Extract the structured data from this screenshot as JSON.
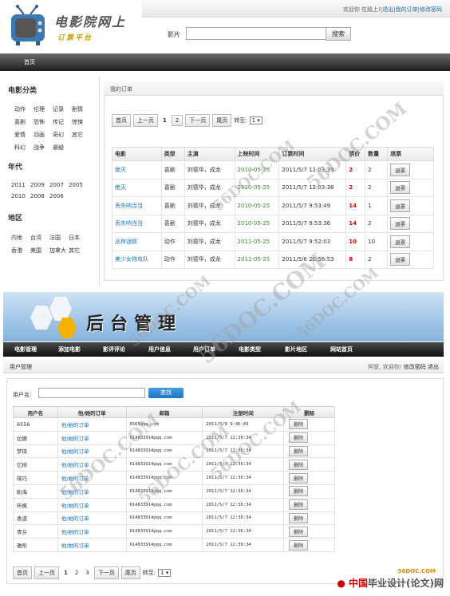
{
  "front": {
    "brand": {
      "line1": "电影院网上",
      "line2": "订票平台"
    },
    "top_links": {
      "greeting": "欢迎你 在路上!",
      "logout": "退出",
      "my_orders": "我的订单",
      "change_password": "修改密码",
      "sep": "|"
    },
    "search": {
      "label": "影片",
      "value": "",
      "button": "搜索"
    },
    "nav": {
      "home": "首页"
    },
    "sidebar": {
      "category_title": "电影分类",
      "categories": [
        "动作",
        "伦理",
        "记录",
        "剧情",
        "喜剧",
        "恐怖",
        "传记",
        "惊悚",
        "爱情",
        "动画",
        "奇幻",
        "其它",
        "科幻",
        "战争",
        "悬疑"
      ],
      "year_title": "年代",
      "years": [
        "2011",
        "2009",
        "2007",
        "2005",
        "2010",
        "2008",
        "2006"
      ],
      "region_title": "地区",
      "regions": [
        "内地",
        "台湾",
        "法国",
        "日本",
        "香港",
        "美国",
        "加拿大",
        "其它"
      ]
    },
    "orders": {
      "panel_title": "我的订单",
      "pager": {
        "first": "首页",
        "prev": "上一页",
        "pages": [
          "1",
          "2"
        ],
        "current": "1",
        "next": "下一页",
        "last": "尾页",
        "goto": "转至:",
        "select": "1"
      },
      "columns": [
        "电影",
        "类型",
        "主演",
        "上映时间",
        "订票时间",
        "票价",
        "数量",
        "退票"
      ],
      "rows": [
        {
          "movie": "绝灭",
          "type": "喜剧",
          "cast": "刘德华，成龙",
          "release": "2010-05-25",
          "booked": "2011/5/7 12:03:39",
          "price": "2",
          "qty": "2",
          "action": "退票"
        },
        {
          "movie": "绝灭",
          "type": "喜剧",
          "cast": "刘德华，成龙",
          "release": "2010-05-25",
          "booked": "2011/5/7 12:03:38",
          "price": "2",
          "qty": "2",
          "action": "退票"
        },
        {
          "movie": "丢失响当当",
          "type": "喜剧",
          "cast": "刘德华，成龙",
          "release": "2010-05-25",
          "booked": "2011/5/7 9:53:49",
          "price": "14",
          "qty": "1",
          "action": "退票"
        },
        {
          "movie": "丢失响当当",
          "type": "喜剧",
          "cast": "刘德华，成龙",
          "release": "2010-05-25",
          "booked": "2011/5/7 9:53:36",
          "price": "14",
          "qty": "2",
          "action": "退票"
        },
        {
          "movie": "丛林谜踪",
          "type": "动作",
          "cast": "刘德华，成龙",
          "release": "2011-05-25",
          "booked": "2011/5/7 9:52:03",
          "price": "10",
          "qty": "10",
          "action": "退票"
        },
        {
          "movie": "美少女特攻队",
          "type": "动作",
          "cast": "刘德华，成龙",
          "release": "2011-05-25",
          "booked": "2011/5/6 20:56:53",
          "price": "8",
          "qty": "2",
          "action": "退票"
        }
      ]
    }
  },
  "admin": {
    "title": "后台管理",
    "nav": [
      "电影管理",
      "添加电影",
      "影评评论",
      "用户信息",
      "用户订单",
      "电影类型",
      "影片地区",
      "网站首页"
    ],
    "subbar": {
      "title": "用户管理",
      "greeting": "阿管, 欢迎你!",
      "change_password": "修改密码",
      "logout": "退出"
    },
    "search": {
      "label": "用户名:",
      "value": "",
      "button": "查找"
    },
    "columns": [
      "用户名",
      "他/她的订单",
      "邮箱",
      "注册时间",
      "删除"
    ],
    "users": [
      {
        "name": "6556",
        "orders": "他/她的订单",
        "email": "6565@qq.com",
        "registered": "2011/5/8 9:46:49",
        "action": "删除"
      },
      {
        "name": "拉娜",
        "orders": "他/她的订单",
        "email": "614833914@qq.com",
        "registered": "2011/5/7 12:36:34",
        "action": "删除"
      },
      {
        "name": "梦琪",
        "orders": "他/她的订单",
        "email": "614833914@qq.com",
        "registered": "2011/5/7 12:36:34",
        "action": "删除"
      },
      {
        "name": "忆柳",
        "orders": "他/她的订单",
        "email": "614833914@qq.com",
        "registered": "2011/5/7 12:36:34",
        "action": "删除"
      },
      {
        "name": "晓巧",
        "orders": "他/她的订单",
        "email": "614833914@qq.com",
        "registered": "2011/5/7 12:36:34",
        "action": "删除"
      },
      {
        "name": "盼海",
        "orders": "他/她的订单",
        "email": "614833914@qq.com",
        "registered": "2011/5/7 12:36:34",
        "action": "删除"
      },
      {
        "name": "听枫",
        "orders": "他/她的订单",
        "email": "614833914@qq.com",
        "registered": "2011/5/7 12:36:34",
        "action": "删除"
      },
      {
        "name": "香波",
        "orders": "他/她的订单",
        "email": "614833914@qq.com",
        "registered": "2011/5/7 12:36:34",
        "action": "删除"
      },
      {
        "name": "青芬",
        "orders": "他/她的订单",
        "email": "614833914@qq.com",
        "registered": "2011/5/7 12:36:34",
        "action": "删除"
      },
      {
        "name": "雅彤",
        "orders": "他/她的订单",
        "email": "614833914@qq.com",
        "registered": "2011/5/7 12:36:34",
        "action": "删除"
      }
    ],
    "pager": {
      "first": "首页",
      "prev": "上一页",
      "pages": [
        "1",
        "2",
        "3"
      ],
      "current": "1",
      "next": "下一页",
      "last": "尾页",
      "goto": "转至:",
      "select": "1"
    }
  },
  "watermark": {
    "text": "56DOC.COM"
  },
  "footer": {
    "site": "56DOC.COM",
    "brand_cn": "中国",
    "brand_rest": "毕业设计(论文)网"
  },
  "colors": {
    "link": "#1a6fb3",
    "date": "#3a8a2a",
    "price": "#dd0000",
    "nav_dark": "#1e1e1e",
    "admin_banner": "#9fc4e6",
    "search_button": "#1e74c8"
  }
}
